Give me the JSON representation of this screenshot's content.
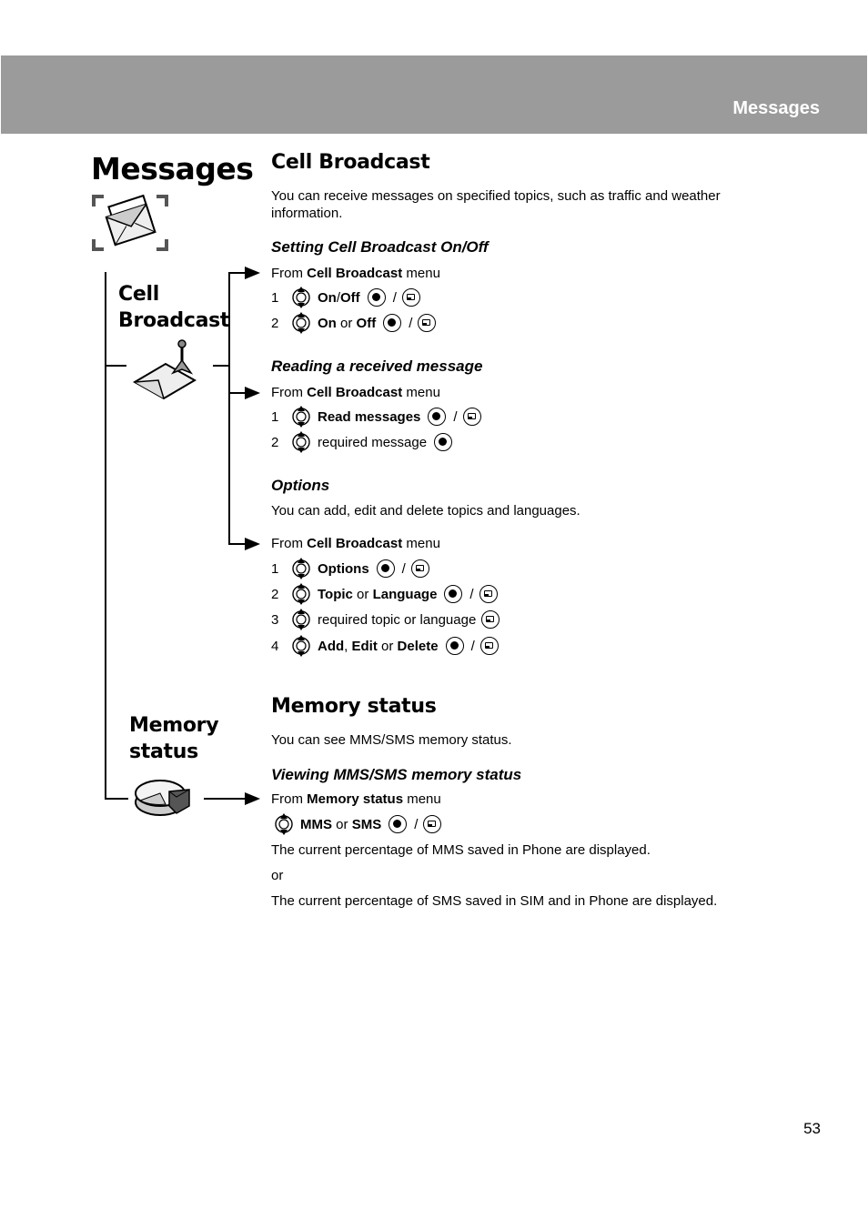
{
  "header": {
    "section": "Messages"
  },
  "page_title": "Messages",
  "side_labels": {
    "cell_broadcast": [
      "Cell",
      "Broadcast"
    ],
    "memory_status": [
      "Memory",
      "status"
    ]
  },
  "icons": {
    "messages": "envelope-icon",
    "cell_broadcast": "broadcast-envelope-icon",
    "memory_status": "pie-chart-icon",
    "navigate": "navigation-key-icon",
    "ok": "ok-key-icon",
    "softkey": "softkey-icon"
  },
  "cell_broadcast": {
    "title": "Cell Broadcast",
    "intro": "You can receive messages on specified topics, such as traffic and weather information.",
    "setting": {
      "title": "Setting Cell Broadcast On/Off",
      "from": [
        "From ",
        "Cell Broadcast",
        " menu"
      ],
      "steps": [
        {
          "num": "1",
          "parts": [
            {
              "t": "On",
              "b": true
            },
            {
              "t": "/",
              "b": false
            },
            {
              "t": "Off",
              "b": true
            }
          ]
        },
        {
          "num": "2",
          "parts": [
            {
              "t": "On",
              "b": true
            },
            {
              "t": " or ",
              "b": false
            },
            {
              "t": "Off",
              "b": true
            }
          ]
        }
      ],
      "step1_a": "On",
      "step1_sep": "/",
      "step1_b": "Off",
      "step2_a": "On",
      "step2_sep": " or ",
      "step2_b": "Off"
    },
    "reading": {
      "title": "Reading a received message",
      "from": [
        "From ",
        "Cell Broadcast",
        " menu"
      ],
      "step1": "Read messages",
      "step2": "required message"
    },
    "options": {
      "title": "Options",
      "intro": "You can add, edit and delete topics and languages.",
      "from": [
        "From ",
        "Cell Broadcast",
        " menu"
      ],
      "step1": "Options",
      "step2_a": "Topic",
      "step2_sep": " or ",
      "step2_b": "Language",
      "step3": "required topic or language",
      "step4_a": "Add",
      "step4_sep1": ", ",
      "step4_b": "Edit",
      "step4_sep2": " or ",
      "step4_c": "Delete"
    },
    "slash": "/"
  },
  "memory_status": {
    "title": "Memory status",
    "intro": "You can see MMS/SMS memory status.",
    "viewing": {
      "title": "Viewing MMS/SMS memory status",
      "from": [
        "From ",
        "Memory status",
        " menu"
      ],
      "step_a": "MMS",
      "step_sep": " or ",
      "step_b": "SMS",
      "result1": "The current percentage of MMS saved in Phone are displayed.",
      "or": "or",
      "result2": "The current percentage of SMS saved in SIM and in Phone are displayed."
    }
  },
  "page_number": "53",
  "step_numbers": [
    "1",
    "2",
    "3",
    "4"
  ]
}
